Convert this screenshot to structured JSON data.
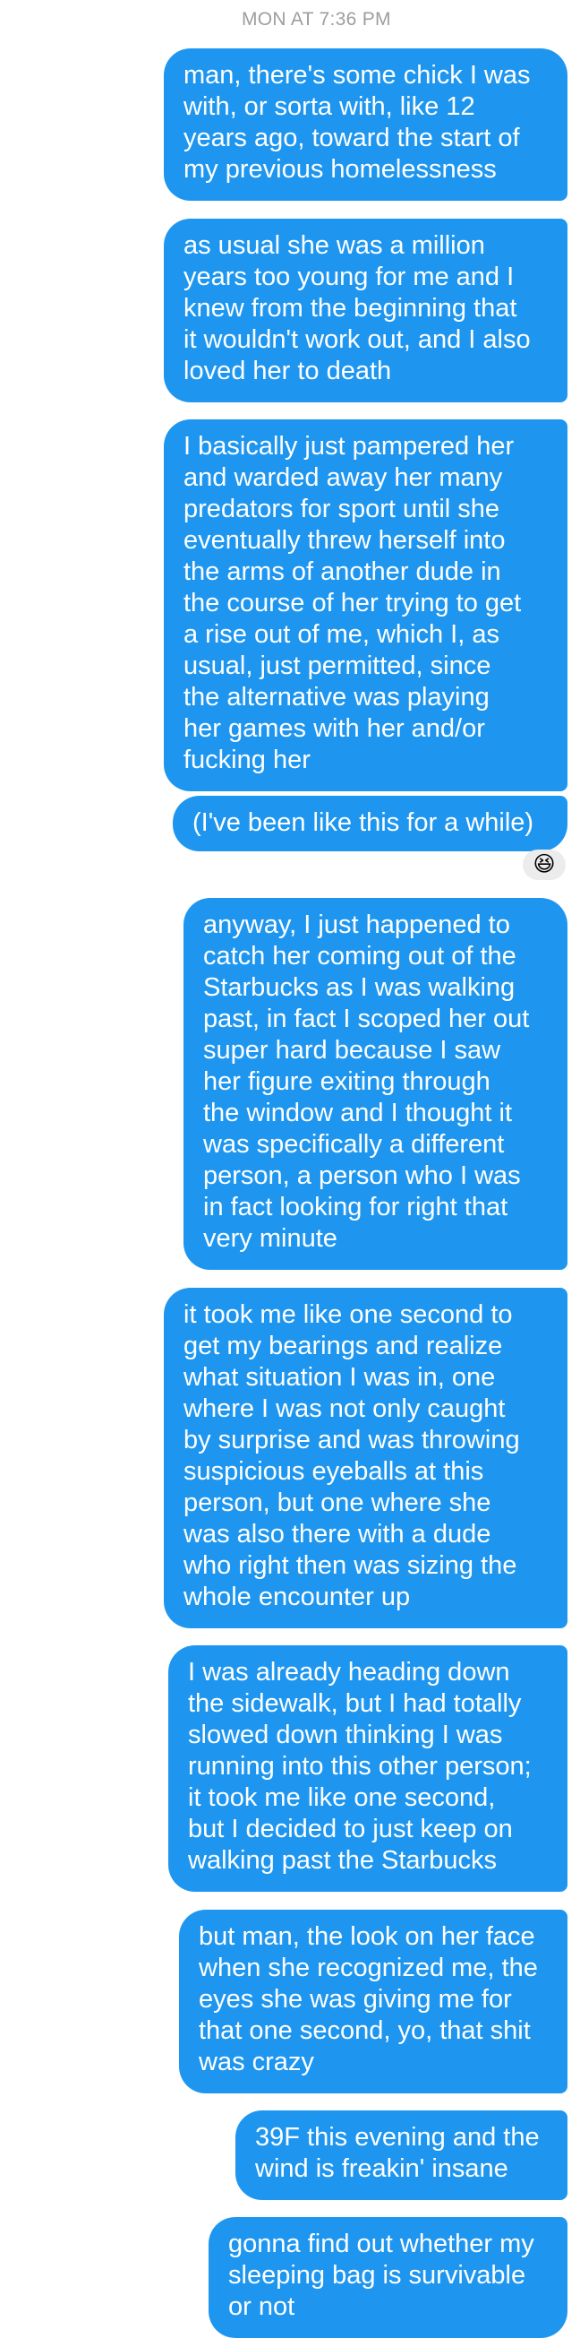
{
  "timestamp": "MON AT 7:36 PM",
  "messages": [
    {
      "lines": [
        "man, there's some chick I was",
        "with, or sorta with, like 12",
        "years ago, toward the start of",
        "my previous homelessness"
      ]
    },
    {
      "lines": [
        "as usual she was a million",
        "years too young for me and I",
        "knew from the beginning that",
        "it wouldn't work out, and I also",
        "loved her to death"
      ]
    },
    {
      "lines": [
        "I basically just pampered her",
        "and warded away her many",
        "predators for sport until she",
        "eventually threw herself into",
        "the arms of another dude in",
        "the course of her trying to get",
        "a rise out of me, which I, as",
        "usual, just permitted, since",
        "the alternative was playing",
        "her games with her and/or",
        "fucking her"
      ]
    },
    {
      "lines": [
        "(I've been like this for a while)"
      ]
    },
    {
      "lines": [
        "anyway, I just happened to",
        "catch her coming out of the",
        "Starbucks as I was walking",
        "past, in fact I scoped her out",
        "super hard because I saw",
        "her figure exiting through",
        "the window and I thought it",
        "was specifically a different",
        "person, a person who I was",
        "in fact looking for right that",
        "very minute"
      ]
    },
    {
      "lines": [
        "it took me like one second to",
        "get my bearings and realize",
        "what situation I was in, one",
        "where I was not only caught",
        "by surprise and was throwing",
        "suspicious eyeballs at this",
        "person, but one where she",
        "was also there with a dude",
        "who right then was sizing the",
        "whole encounter up"
      ]
    },
    {
      "lines": [
        "I was already heading down",
        "the sidewalk, but I had totally",
        "slowed down thinking I was",
        "running into this other person;",
        "it took me like one second,",
        "but I decided to just keep on",
        "walking past the Starbucks"
      ]
    },
    {
      "lines": [
        "but man, the look on her face",
        "when she recognized me, the",
        "eyes she was giving me for",
        "that one second, yo, that shit",
        "was crazy"
      ]
    },
    {
      "lines": [
        "39F this evening and the",
        "wind is freakin' insane"
      ]
    },
    {
      "lines": [
        "gonna find out whether my",
        "sleeping bag is survivable",
        "or not"
      ]
    }
  ],
  "reaction": {
    "emoji": "😆",
    "icon": "laughing-emoji"
  },
  "colors": {
    "bubble": "#1e96f0",
    "bubble_text": "#ffffff",
    "timestamp": "#9e9e9e",
    "reaction_bg": "#ececec"
  }
}
